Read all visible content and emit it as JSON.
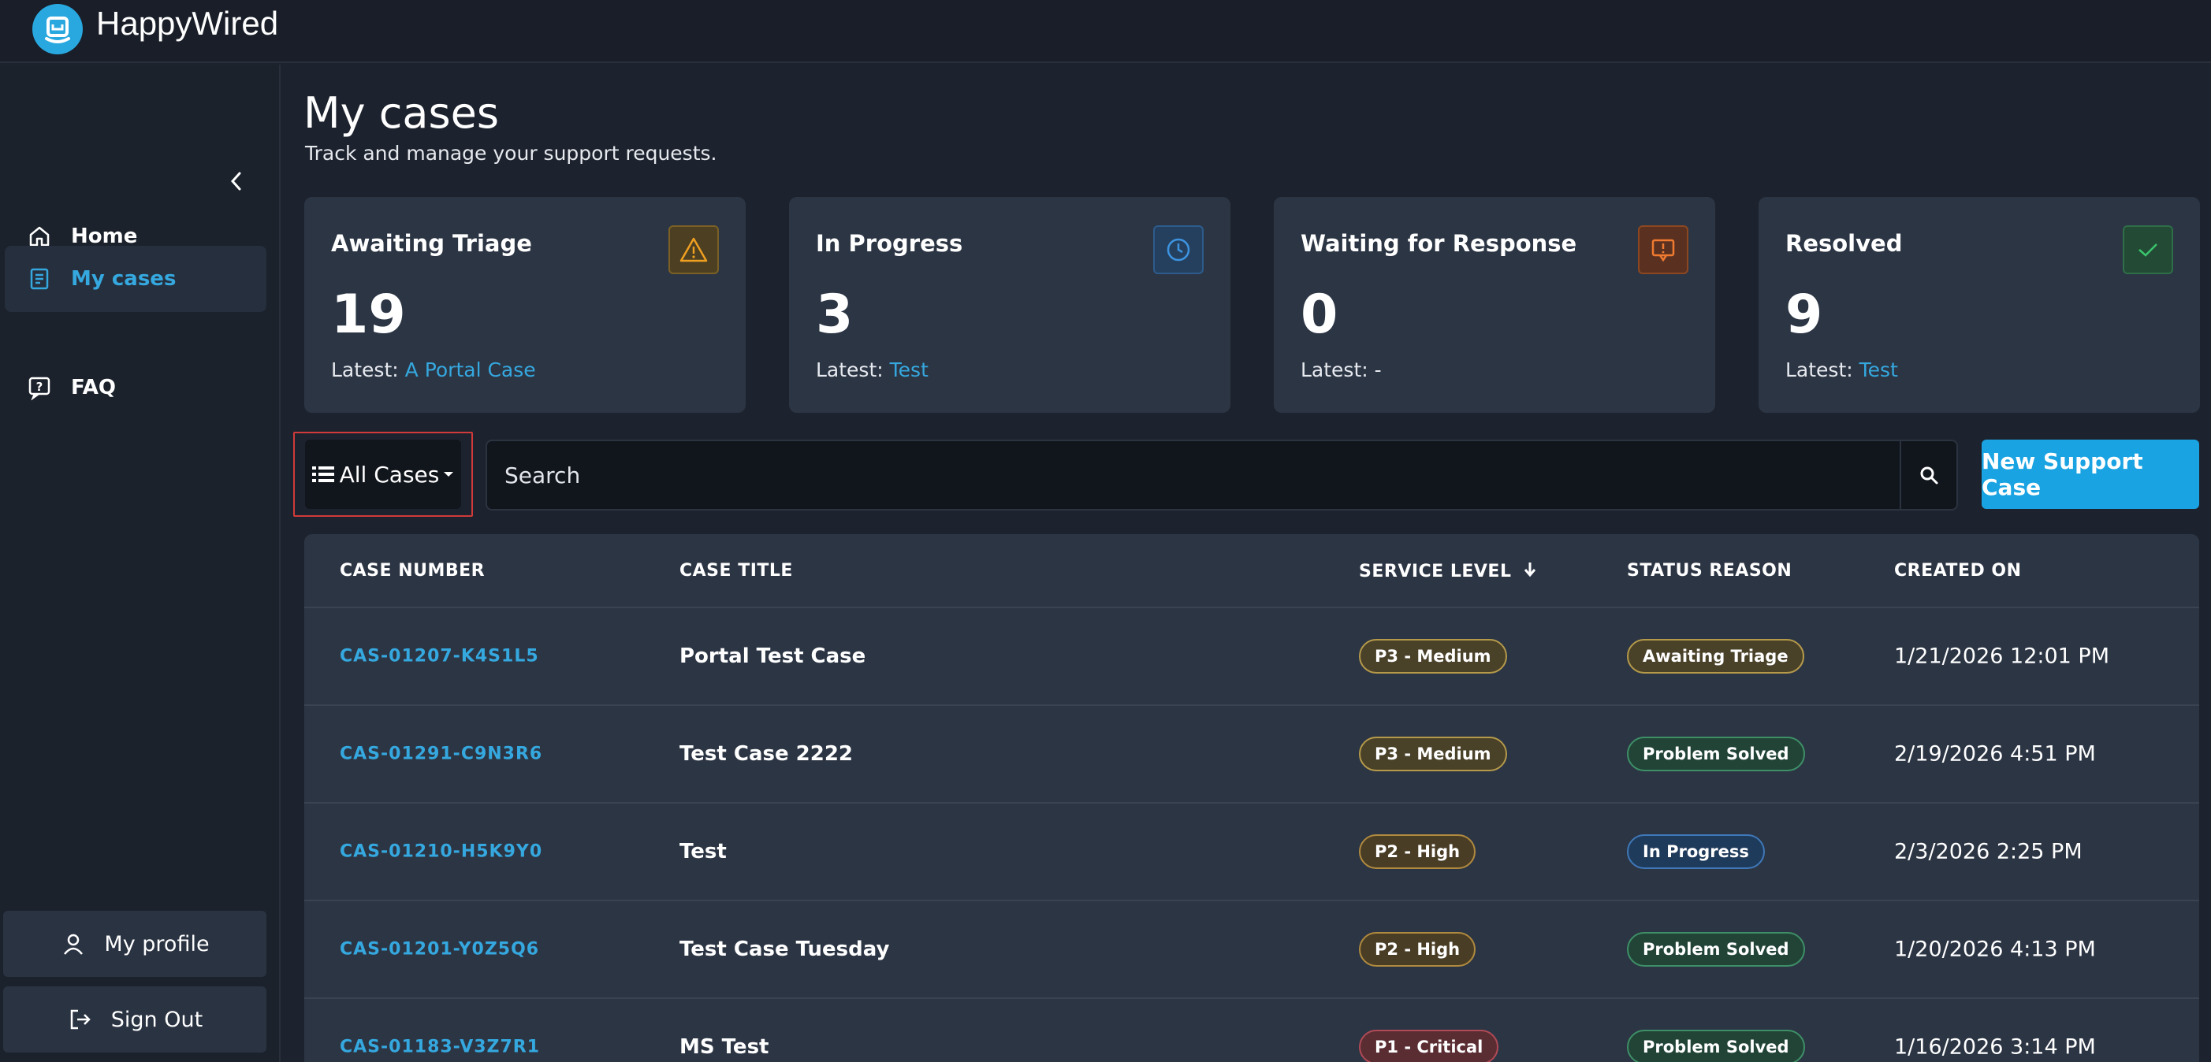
{
  "app": {
    "name": "HappyWired"
  },
  "sidebar": {
    "items": [
      {
        "label": "Home",
        "icon": "home-icon"
      },
      {
        "label": "My cases",
        "icon": "cases-icon",
        "active": true
      },
      {
        "label": "FAQ",
        "icon": "faq-icon"
      }
    ],
    "profile_label": "My profile",
    "signout_label": "Sign Out"
  },
  "page": {
    "title": "My cases",
    "subtitle": "Track and manage your support requests."
  },
  "cards": [
    {
      "title": "Awaiting Triage",
      "count": "19",
      "latest_prefix": "Latest:",
      "latest_link": "A Portal Case",
      "icon": "warning-icon",
      "accent": "#e89a1c"
    },
    {
      "title": "In Progress",
      "count": "3",
      "latest_prefix": "Latest:",
      "latest_link": "Test",
      "icon": "clock-icon",
      "accent": "#2f86d6"
    },
    {
      "title": "Waiting for Response",
      "count": "0",
      "latest_prefix": "Latest: -",
      "latest_link": "",
      "icon": "message-alert-icon",
      "accent": "#e5661e"
    },
    {
      "title": "Resolved",
      "count": "9",
      "latest_prefix": "Latest:",
      "latest_link": "Test",
      "icon": "check-icon",
      "accent": "#2fae5a"
    }
  ],
  "toolbar": {
    "filter_label": "All Cases",
    "search_placeholder": "Search",
    "new_case_label": "New Support Case"
  },
  "table": {
    "headers": {
      "case_number": "CASE NUMBER",
      "case_title": "CASE TITLE",
      "service_level": "SERVICE LEVEL",
      "status_reason": "STATUS REASON",
      "created_on": "CREATED ON"
    },
    "rows": [
      {
        "case_number": "CAS-01207-K4S1L5",
        "title": "Portal Test Case",
        "level": "P3 - Medium",
        "status": "Awaiting Triage",
        "created": "1/21/2026 12:01 PM"
      },
      {
        "case_number": "CAS-01291-C9N3R6",
        "title": "Test Case 2222",
        "level": "P3 - Medium",
        "status": "Problem Solved",
        "created": "2/19/2026 4:51 PM"
      },
      {
        "case_number": "CAS-01210-H5K9Y0",
        "title": "Test",
        "level": "P2 - High",
        "status": "In Progress",
        "created": "2/3/2026 2:25 PM"
      },
      {
        "case_number": "CAS-01201-Y0Z5Q6",
        "title": "Test Case Tuesday",
        "level": "P2 - High",
        "status": "Problem Solved",
        "created": "1/20/2026 4:13 PM"
      },
      {
        "case_number": "CAS-01183-V3Z7R1",
        "title": "MS Test",
        "level": "P1 - Critical",
        "status": "Problem Solved",
        "created": "1/16/2026 3:14 PM"
      }
    ]
  },
  "colors": {
    "accent": "#1aa3e2",
    "pill_medium_bg": "#4a4129",
    "pill_medium_border": "#b59a4a",
    "pill_high_bg": "#4a3d26",
    "pill_high_border": "#b08a3e",
    "pill_critical_bg": "#5a2d33",
    "pill_critical_border": "#b04a56",
    "pill_triage_bg": "#4a4129",
    "pill_triage_border": "#b59a4a",
    "pill_solved_bg": "#214437",
    "pill_solved_border": "#3e8f67",
    "pill_progress_bg": "#1f3b5c",
    "pill_progress_border": "#3f78b8"
  }
}
